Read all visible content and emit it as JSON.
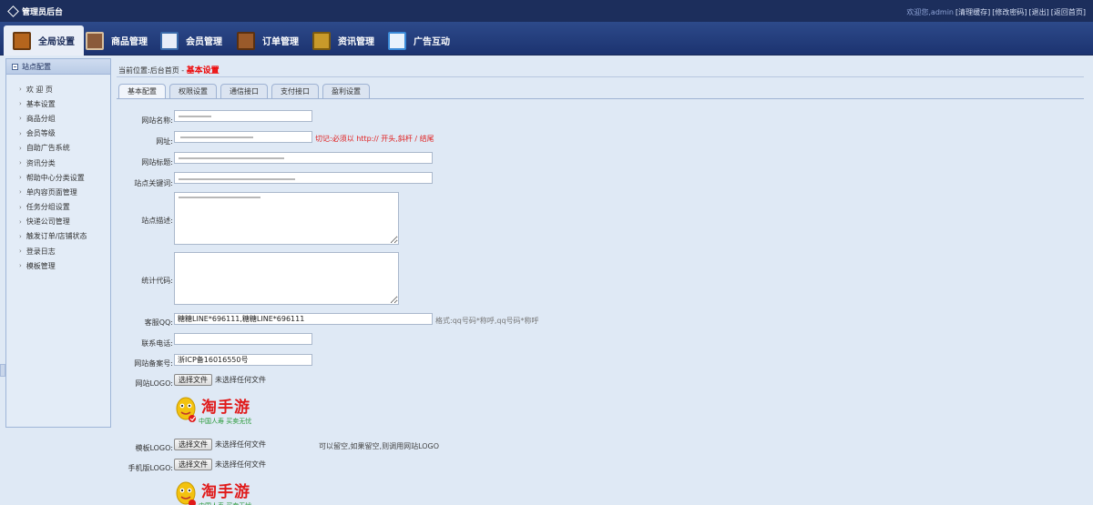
{
  "topbar": {
    "brand": "管理员后台",
    "welcome": "欢迎您,admin",
    "links": [
      "[清理缓存]",
      "[修改密码]",
      "[退出]",
      "[返回首页]"
    ]
  },
  "nav": {
    "tabs": [
      {
        "label": "全局设置",
        "icon": "globe-settings-icon",
        "color": "#b5651d"
      },
      {
        "label": "商品管理",
        "icon": "products-icon",
        "color": "#8a5a3a"
      },
      {
        "label": "会员管理",
        "icon": "members-icon",
        "color": "#3a6aa8"
      },
      {
        "label": "订单管理",
        "icon": "orders-icon",
        "color": "#9a5a2a"
      },
      {
        "label": "资讯管理",
        "icon": "news-icon",
        "color": "#c89a2a"
      },
      {
        "label": "广告互动",
        "icon": "ads-icon",
        "color": "#3a8ad8"
      }
    ]
  },
  "sidebar": {
    "title": "站点配置",
    "items": [
      "欢 迎 页",
      "基本设置",
      "商品分组",
      "会员等级",
      "自助广告系统",
      "资讯分类",
      "帮助中心分类设置",
      "单内容页面管理",
      "任务分组设置",
      "快递公司管理",
      "触发订单/店铺状态",
      "登录日志",
      "模板管理"
    ]
  },
  "breadcrumb": {
    "prefix": "当前位置:后台首页 - ",
    "current": "基本设置"
  },
  "tabs": [
    "基本配置",
    "权限设置",
    "通信接口",
    "支付接口",
    "盈利设置"
  ],
  "form": {
    "site_name": {
      "label": "网站名称:",
      "value": ""
    },
    "url": {
      "label": "网址:",
      "value": "",
      "hint": "切记:必须以 http:// 开头,斜杆 / 结尾"
    },
    "site_title": {
      "label": "网站标题:",
      "value": ""
    },
    "keywords": {
      "label": "站点关键词:",
      "value": ""
    },
    "description": {
      "label": "站点描述:",
      "value": ""
    },
    "stats_code": {
      "label": "统计代码:",
      "value": ""
    },
    "qq": {
      "label": "客服QQ:",
      "value": "糖糖LINE*696111,糖糖LINE*696111",
      "hint": "格式:qq号码*称呼,qq号码*称呼"
    },
    "phone": {
      "label": "联系电话:",
      "value": ""
    },
    "icp": {
      "label": "网站备案号:",
      "value": "浙ICP备16016550号"
    },
    "logo": {
      "label": "网站LOGO:",
      "button": "选择文件",
      "status": "未选择任何文件"
    },
    "template_logo": {
      "label": "模板LOGO:",
      "button": "选择文件",
      "status": "未选择任何文件",
      "hint": "可以留空,如果留空,则调用网站LOGO"
    },
    "mobile_logo": {
      "label": "手机版LOGO:",
      "button": "选择文件",
      "status": "未选择任何文件"
    }
  },
  "logo_preview": {
    "brand": "淘手游",
    "slogan": "中国人寿 买卖无忧",
    "brand_color": "#e01a1a",
    "slogan_color": "#2a9a3a"
  }
}
